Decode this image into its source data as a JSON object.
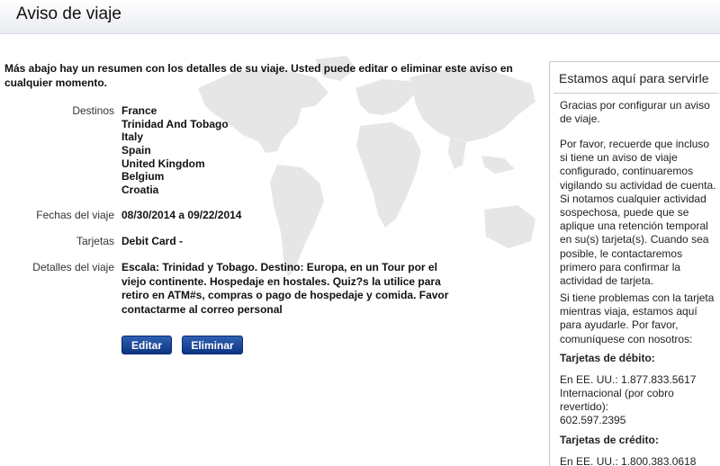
{
  "header": {
    "title": "Aviso de viaje"
  },
  "main": {
    "intro": "Más abajo hay un resumen con los detalles de su viaje. Usted puede editar o eliminar este aviso en cualquier momento.",
    "destinations_label": "Destinos",
    "destinations": [
      "France",
      "Trinidad And Tobago",
      "Italy",
      "Spain",
      "United Kingdom",
      "Belgium",
      "Croatia"
    ],
    "dates_label": "Fechas del viaje",
    "dates_value": "08/30/2014 a 09/22/2014",
    "cards_label": "Tarjetas",
    "cards_value": "Debit Card -",
    "details_label": "Detalles del viaje",
    "details_value": "Escala: Trinidad y Tobago. Destino: Europa, en un Tour por el viejo continente. Hospedaje en hostales. Quiz?s la utilice para retiro en ATM#s, compras o pago de hospedaje y comida. Favor contactarme al correo personal",
    "edit_label": "Editar",
    "delete_label": "Eliminar"
  },
  "sidebar": {
    "title": "Estamos aquí para servirle",
    "p1": "Gracias por configurar un aviso de viaje.",
    "p2": "Por favor, recuerde que incluso si tiene un aviso de viaje configurado, continuaremos vigilando su actividad de cuenta. Si notamos cualquier actividad sospechosa, puede que se aplique una retención temporal en su(s) tarjeta(s). Cuando sea posible, le contactaremos primero para confirmar la actividad de tarjeta.",
    "p3": "Si tiene problemas con la tarjeta mientras viaja, estamos aquí para ayudarle. Por favor, comuníquese con nosotros:",
    "debit_heading": "Tarjetas de débito:",
    "debit_us": "En EE. UU.: 1.877.833.5617",
    "debit_intl": "Internacional (por cobro revertido):",
    "debit_intl_number": "602.597.2395",
    "credit_heading": "Tarjetas de crédito:",
    "credit_us": "En EE. UU.: 1.800.383.0618"
  }
}
